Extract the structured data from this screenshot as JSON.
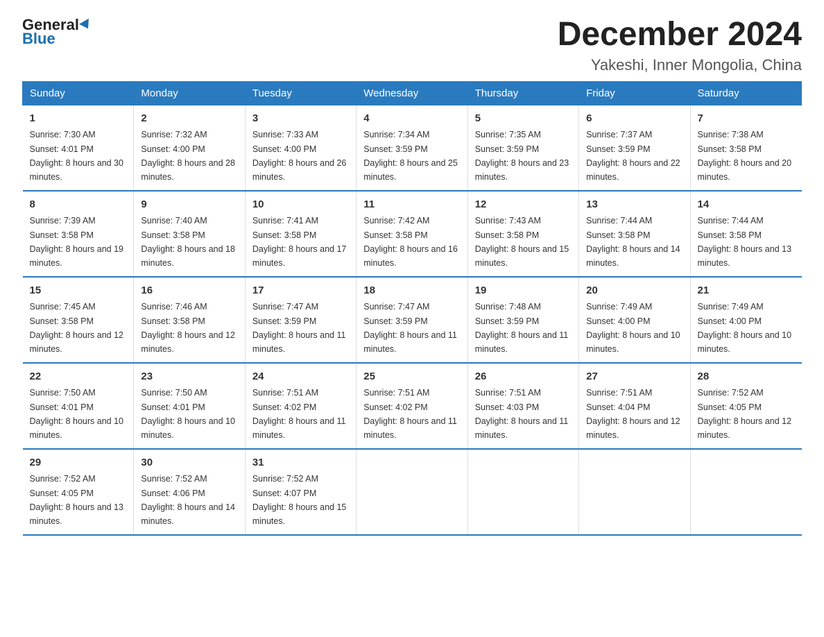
{
  "header": {
    "logo_general": "General",
    "logo_blue": "Blue",
    "month_title": "December 2024",
    "location": "Yakeshi, Inner Mongolia, China"
  },
  "columns": [
    "Sunday",
    "Monday",
    "Tuesday",
    "Wednesday",
    "Thursday",
    "Friday",
    "Saturday"
  ],
  "weeks": [
    [
      {
        "day": "1",
        "sunrise": "7:30 AM",
        "sunset": "4:01 PM",
        "daylight": "8 hours and 30 minutes."
      },
      {
        "day": "2",
        "sunrise": "7:32 AM",
        "sunset": "4:00 PM",
        "daylight": "8 hours and 28 minutes."
      },
      {
        "day": "3",
        "sunrise": "7:33 AM",
        "sunset": "4:00 PM",
        "daylight": "8 hours and 26 minutes."
      },
      {
        "day": "4",
        "sunrise": "7:34 AM",
        "sunset": "3:59 PM",
        "daylight": "8 hours and 25 minutes."
      },
      {
        "day": "5",
        "sunrise": "7:35 AM",
        "sunset": "3:59 PM",
        "daylight": "8 hours and 23 minutes."
      },
      {
        "day": "6",
        "sunrise": "7:37 AM",
        "sunset": "3:59 PM",
        "daylight": "8 hours and 22 minutes."
      },
      {
        "day": "7",
        "sunrise": "7:38 AM",
        "sunset": "3:58 PM",
        "daylight": "8 hours and 20 minutes."
      }
    ],
    [
      {
        "day": "8",
        "sunrise": "7:39 AM",
        "sunset": "3:58 PM",
        "daylight": "8 hours and 19 minutes."
      },
      {
        "day": "9",
        "sunrise": "7:40 AM",
        "sunset": "3:58 PM",
        "daylight": "8 hours and 18 minutes."
      },
      {
        "day": "10",
        "sunrise": "7:41 AM",
        "sunset": "3:58 PM",
        "daylight": "8 hours and 17 minutes."
      },
      {
        "day": "11",
        "sunrise": "7:42 AM",
        "sunset": "3:58 PM",
        "daylight": "8 hours and 16 minutes."
      },
      {
        "day": "12",
        "sunrise": "7:43 AM",
        "sunset": "3:58 PM",
        "daylight": "8 hours and 15 minutes."
      },
      {
        "day": "13",
        "sunrise": "7:44 AM",
        "sunset": "3:58 PM",
        "daylight": "8 hours and 14 minutes."
      },
      {
        "day": "14",
        "sunrise": "7:44 AM",
        "sunset": "3:58 PM",
        "daylight": "8 hours and 13 minutes."
      }
    ],
    [
      {
        "day": "15",
        "sunrise": "7:45 AM",
        "sunset": "3:58 PM",
        "daylight": "8 hours and 12 minutes."
      },
      {
        "day": "16",
        "sunrise": "7:46 AM",
        "sunset": "3:58 PM",
        "daylight": "8 hours and 12 minutes."
      },
      {
        "day": "17",
        "sunrise": "7:47 AM",
        "sunset": "3:59 PM",
        "daylight": "8 hours and 11 minutes."
      },
      {
        "day": "18",
        "sunrise": "7:47 AM",
        "sunset": "3:59 PM",
        "daylight": "8 hours and 11 minutes."
      },
      {
        "day": "19",
        "sunrise": "7:48 AM",
        "sunset": "3:59 PM",
        "daylight": "8 hours and 11 minutes."
      },
      {
        "day": "20",
        "sunrise": "7:49 AM",
        "sunset": "4:00 PM",
        "daylight": "8 hours and 10 minutes."
      },
      {
        "day": "21",
        "sunrise": "7:49 AM",
        "sunset": "4:00 PM",
        "daylight": "8 hours and 10 minutes."
      }
    ],
    [
      {
        "day": "22",
        "sunrise": "7:50 AM",
        "sunset": "4:01 PM",
        "daylight": "8 hours and 10 minutes."
      },
      {
        "day": "23",
        "sunrise": "7:50 AM",
        "sunset": "4:01 PM",
        "daylight": "8 hours and 10 minutes."
      },
      {
        "day": "24",
        "sunrise": "7:51 AM",
        "sunset": "4:02 PM",
        "daylight": "8 hours and 11 minutes."
      },
      {
        "day": "25",
        "sunrise": "7:51 AM",
        "sunset": "4:02 PM",
        "daylight": "8 hours and 11 minutes."
      },
      {
        "day": "26",
        "sunrise": "7:51 AM",
        "sunset": "4:03 PM",
        "daylight": "8 hours and 11 minutes."
      },
      {
        "day": "27",
        "sunrise": "7:51 AM",
        "sunset": "4:04 PM",
        "daylight": "8 hours and 12 minutes."
      },
      {
        "day": "28",
        "sunrise": "7:52 AM",
        "sunset": "4:05 PM",
        "daylight": "8 hours and 12 minutes."
      }
    ],
    [
      {
        "day": "29",
        "sunrise": "7:52 AM",
        "sunset": "4:05 PM",
        "daylight": "8 hours and 13 minutes."
      },
      {
        "day": "30",
        "sunrise": "7:52 AM",
        "sunset": "4:06 PM",
        "daylight": "8 hours and 14 minutes."
      },
      {
        "day": "31",
        "sunrise": "7:52 AM",
        "sunset": "4:07 PM",
        "daylight": "8 hours and 15 minutes."
      },
      null,
      null,
      null,
      null
    ]
  ]
}
